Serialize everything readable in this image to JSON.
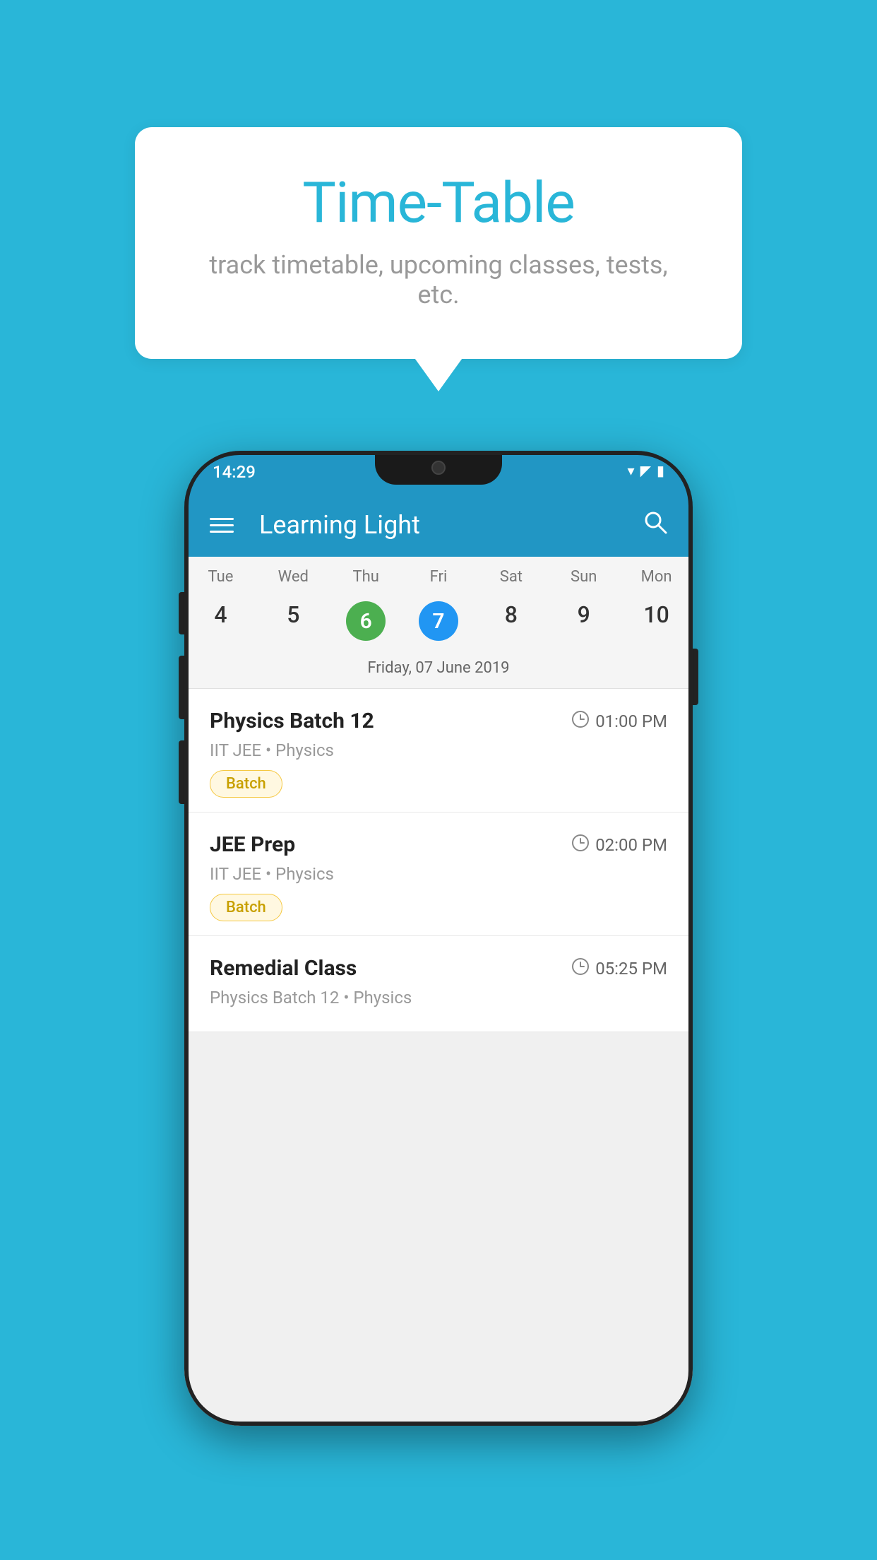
{
  "background": "#29b6d8",
  "bubble": {
    "title": "Time-Table",
    "subtitle": "track timetable, upcoming classes, tests, etc."
  },
  "phone": {
    "status": {
      "time": "14:29"
    },
    "appBar": {
      "title": "Learning Light"
    },
    "calendar": {
      "days": [
        {
          "name": "Tue",
          "number": "4",
          "type": "normal"
        },
        {
          "name": "Wed",
          "number": "5",
          "type": "normal"
        },
        {
          "name": "Thu",
          "number": "6",
          "type": "green"
        },
        {
          "name": "Fri",
          "number": "7",
          "type": "blue"
        },
        {
          "name": "Sat",
          "number": "8",
          "type": "normal"
        },
        {
          "name": "Sun",
          "number": "9",
          "type": "normal"
        },
        {
          "name": "Mon",
          "number": "10",
          "type": "normal"
        }
      ],
      "selectedDate": "Friday, 07 June 2019"
    },
    "schedule": [
      {
        "title": "Physics Batch 12",
        "time": "01:00 PM",
        "subtitle": "IIT JEE • Physics",
        "badge": "Batch"
      },
      {
        "title": "JEE Prep",
        "time": "02:00 PM",
        "subtitle": "IIT JEE • Physics",
        "badge": "Batch"
      },
      {
        "title": "Remedial Class",
        "time": "05:25 PM",
        "subtitle": "Physics Batch 12 • Physics",
        "badge": ""
      }
    ]
  }
}
